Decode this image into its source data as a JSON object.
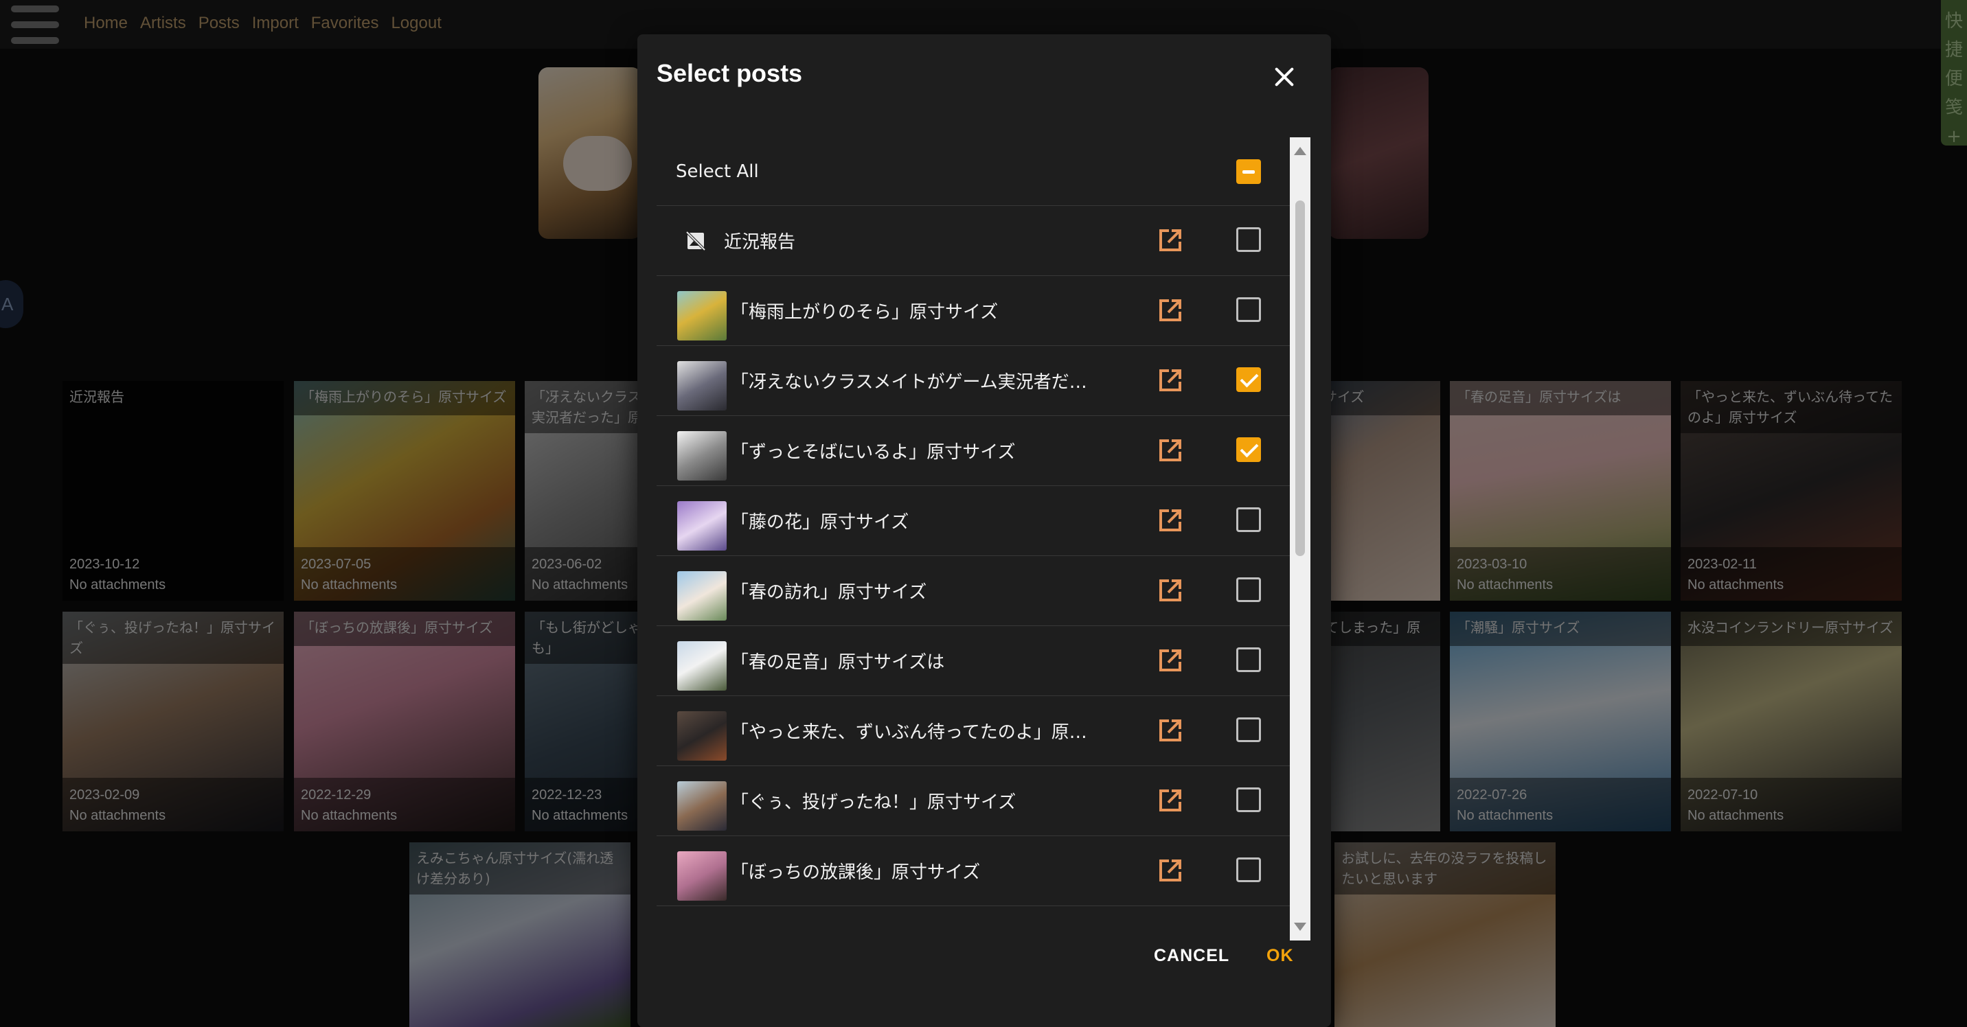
{
  "nav": {
    "links": [
      "Home",
      "Artists",
      "Posts",
      "Import",
      "Favorites",
      "Logout"
    ]
  },
  "side_note": {
    "chars": [
      "快",
      "捷",
      "便",
      "笺",
      "+"
    ]
  },
  "side_circle": {
    "label": "A"
  },
  "background_cards": [
    {
      "title": "近況報告",
      "date": "2023-10-12",
      "attachments": "No attachments"
    },
    {
      "title": "「梅雨上がりのそら」原寸サイズ",
      "date": "2023-07-05",
      "attachments": "No attachments"
    },
    {
      "title": "「冴えないクラスメイトがゲーム実況者だった」原",
      "date": "2023-06-02",
      "attachments": "No attachments"
    },
    {
      "title": "サイズ",
      "date": "",
      "attachments": ""
    },
    {
      "title": "「春の足音」原寸サイズは",
      "date": "2023-03-10",
      "attachments": "No attachments"
    },
    {
      "title": "「やっと来た、ずいぶん待ってたのよ」原寸サイズ",
      "date": "2023-02-11",
      "attachments": "No attachments"
    },
    {
      "title": "「ぐぅ、投げったね！」原寸サイズ",
      "date": "2023-02-09",
      "attachments": "No attachments"
    },
    {
      "title": "「ぼっちの放課後」原寸サイズ",
      "date": "2022-12-29",
      "attachments": "No attachments"
    },
    {
      "title": "「もし街がどしゃ なったとしても」",
      "date": "2022-12-23",
      "attachments": "No attachments"
    },
    {
      "title": "てしまった」原",
      "date": "",
      "attachments": ""
    },
    {
      "title": "「潮騒」原寸サイズ",
      "date": "2022-07-26",
      "attachments": "No attachments"
    },
    {
      "title": "水没コインランドリー原寸サイズ",
      "date": "2022-07-10",
      "attachments": "No attachments"
    },
    {
      "title": "えみこちゃん原寸サイズ(濡れ透け差分あり)",
      "date": "",
      "attachments": ""
    },
    {
      "title": "お試しに、去年の没ラフを投稿したいと思います",
      "date": "",
      "attachments": ""
    }
  ],
  "modal": {
    "title": "Select posts",
    "select_all_label": "Select All",
    "select_all_state": "indeterminate",
    "posts": [
      {
        "title": "近況報告",
        "has_thumbnail": false,
        "selected": false
      },
      {
        "title": "「梅雨上がりのそら」原寸サイズ",
        "has_thumbnail": true,
        "selected": false
      },
      {
        "title": "「冴えないクラスメイトがゲーム実況者だっ…",
        "has_thumbnail": true,
        "selected": true
      },
      {
        "title": "「ずっとそばにいるよ」原寸サイズ",
        "has_thumbnail": true,
        "selected": true
      },
      {
        "title": "「藤の花」原寸サイズ",
        "has_thumbnail": true,
        "selected": false
      },
      {
        "title": "「春の訪れ」原寸サイズ",
        "has_thumbnail": true,
        "selected": false
      },
      {
        "title": "「春の足音」原寸サイズは",
        "has_thumbnail": true,
        "selected": false
      },
      {
        "title": "「やっと来た、ずいぶん待ってたのよ」原寸…",
        "has_thumbnail": true,
        "selected": false
      },
      {
        "title": "「ぐぅ、投げったね！」原寸サイズ",
        "has_thumbnail": true,
        "selected": false
      },
      {
        "title": "「ぼっちの放課後」原寸サイズ",
        "has_thumbnail": true,
        "selected": false
      }
    ],
    "cancel_label": "CANCEL",
    "ok_label": "OK"
  },
  "colors": {
    "accent": "#f4a30b",
    "external_link": "#e8965a",
    "nav_link": "#c2a06e"
  }
}
